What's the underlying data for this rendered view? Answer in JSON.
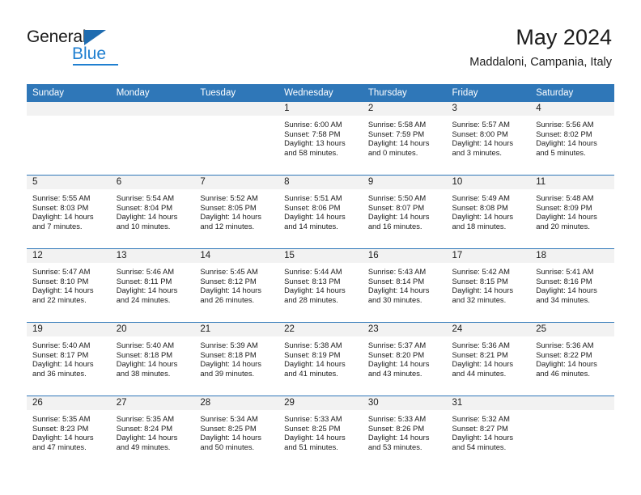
{
  "brand": {
    "name_part1": "General",
    "name_part2": "Blue",
    "triangle_color": "#1f6cb0",
    "blue_color": "#1f7fd0"
  },
  "header": {
    "title": "May 2024",
    "subtitle": "Maddaloni, Campania, Italy",
    "header_bg": "#2f77b8",
    "daynum_bg": "#f2f2f2"
  },
  "weekdays": [
    "Sunday",
    "Monday",
    "Tuesday",
    "Wednesday",
    "Thursday",
    "Friday",
    "Saturday"
  ],
  "labels": {
    "sunrise": "Sunrise:",
    "sunset": "Sunset:",
    "daylight": "Daylight:"
  },
  "weeks": [
    [
      {
        "empty": true
      },
      {
        "empty": true
      },
      {
        "empty": true
      },
      {
        "day": "1",
        "sunrise": "Sunrise: 6:00 AM",
        "sunset": "Sunset: 7:58 PM",
        "daylight_l1": "Daylight: 13 hours",
        "daylight_l2": "and 58 minutes."
      },
      {
        "day": "2",
        "sunrise": "Sunrise: 5:58 AM",
        "sunset": "Sunset: 7:59 PM",
        "daylight_l1": "Daylight: 14 hours",
        "daylight_l2": "and 0 minutes."
      },
      {
        "day": "3",
        "sunrise": "Sunrise: 5:57 AM",
        "sunset": "Sunset: 8:00 PM",
        "daylight_l1": "Daylight: 14 hours",
        "daylight_l2": "and 3 minutes."
      },
      {
        "day": "4",
        "sunrise": "Sunrise: 5:56 AM",
        "sunset": "Sunset: 8:02 PM",
        "daylight_l1": "Daylight: 14 hours",
        "daylight_l2": "and 5 minutes."
      }
    ],
    [
      {
        "day": "5",
        "sunrise": "Sunrise: 5:55 AM",
        "sunset": "Sunset: 8:03 PM",
        "daylight_l1": "Daylight: 14 hours",
        "daylight_l2": "and 7 minutes."
      },
      {
        "day": "6",
        "sunrise": "Sunrise: 5:54 AM",
        "sunset": "Sunset: 8:04 PM",
        "daylight_l1": "Daylight: 14 hours",
        "daylight_l2": "and 10 minutes."
      },
      {
        "day": "7",
        "sunrise": "Sunrise: 5:52 AM",
        "sunset": "Sunset: 8:05 PM",
        "daylight_l1": "Daylight: 14 hours",
        "daylight_l2": "and 12 minutes."
      },
      {
        "day": "8",
        "sunrise": "Sunrise: 5:51 AM",
        "sunset": "Sunset: 8:06 PM",
        "daylight_l1": "Daylight: 14 hours",
        "daylight_l2": "and 14 minutes."
      },
      {
        "day": "9",
        "sunrise": "Sunrise: 5:50 AM",
        "sunset": "Sunset: 8:07 PM",
        "daylight_l1": "Daylight: 14 hours",
        "daylight_l2": "and 16 minutes."
      },
      {
        "day": "10",
        "sunrise": "Sunrise: 5:49 AM",
        "sunset": "Sunset: 8:08 PM",
        "daylight_l1": "Daylight: 14 hours",
        "daylight_l2": "and 18 minutes."
      },
      {
        "day": "11",
        "sunrise": "Sunrise: 5:48 AM",
        "sunset": "Sunset: 8:09 PM",
        "daylight_l1": "Daylight: 14 hours",
        "daylight_l2": "and 20 minutes."
      }
    ],
    [
      {
        "day": "12",
        "sunrise": "Sunrise: 5:47 AM",
        "sunset": "Sunset: 8:10 PM",
        "daylight_l1": "Daylight: 14 hours",
        "daylight_l2": "and 22 minutes."
      },
      {
        "day": "13",
        "sunrise": "Sunrise: 5:46 AM",
        "sunset": "Sunset: 8:11 PM",
        "daylight_l1": "Daylight: 14 hours",
        "daylight_l2": "and 24 minutes."
      },
      {
        "day": "14",
        "sunrise": "Sunrise: 5:45 AM",
        "sunset": "Sunset: 8:12 PM",
        "daylight_l1": "Daylight: 14 hours",
        "daylight_l2": "and 26 minutes."
      },
      {
        "day": "15",
        "sunrise": "Sunrise: 5:44 AM",
        "sunset": "Sunset: 8:13 PM",
        "daylight_l1": "Daylight: 14 hours",
        "daylight_l2": "and 28 minutes."
      },
      {
        "day": "16",
        "sunrise": "Sunrise: 5:43 AM",
        "sunset": "Sunset: 8:14 PM",
        "daylight_l1": "Daylight: 14 hours",
        "daylight_l2": "and 30 minutes."
      },
      {
        "day": "17",
        "sunrise": "Sunrise: 5:42 AM",
        "sunset": "Sunset: 8:15 PM",
        "daylight_l1": "Daylight: 14 hours",
        "daylight_l2": "and 32 minutes."
      },
      {
        "day": "18",
        "sunrise": "Sunrise: 5:41 AM",
        "sunset": "Sunset: 8:16 PM",
        "daylight_l1": "Daylight: 14 hours",
        "daylight_l2": "and 34 minutes."
      }
    ],
    [
      {
        "day": "19",
        "sunrise": "Sunrise: 5:40 AM",
        "sunset": "Sunset: 8:17 PM",
        "daylight_l1": "Daylight: 14 hours",
        "daylight_l2": "and 36 minutes."
      },
      {
        "day": "20",
        "sunrise": "Sunrise: 5:40 AM",
        "sunset": "Sunset: 8:18 PM",
        "daylight_l1": "Daylight: 14 hours",
        "daylight_l2": "and 38 minutes."
      },
      {
        "day": "21",
        "sunrise": "Sunrise: 5:39 AM",
        "sunset": "Sunset: 8:18 PM",
        "daylight_l1": "Daylight: 14 hours",
        "daylight_l2": "and 39 minutes."
      },
      {
        "day": "22",
        "sunrise": "Sunrise: 5:38 AM",
        "sunset": "Sunset: 8:19 PM",
        "daylight_l1": "Daylight: 14 hours",
        "daylight_l2": "and 41 minutes."
      },
      {
        "day": "23",
        "sunrise": "Sunrise: 5:37 AM",
        "sunset": "Sunset: 8:20 PM",
        "daylight_l1": "Daylight: 14 hours",
        "daylight_l2": "and 43 minutes."
      },
      {
        "day": "24",
        "sunrise": "Sunrise: 5:36 AM",
        "sunset": "Sunset: 8:21 PM",
        "daylight_l1": "Daylight: 14 hours",
        "daylight_l2": "and 44 minutes."
      },
      {
        "day": "25",
        "sunrise": "Sunrise: 5:36 AM",
        "sunset": "Sunset: 8:22 PM",
        "daylight_l1": "Daylight: 14 hours",
        "daylight_l2": "and 46 minutes."
      }
    ],
    [
      {
        "day": "26",
        "sunrise": "Sunrise: 5:35 AM",
        "sunset": "Sunset: 8:23 PM",
        "daylight_l1": "Daylight: 14 hours",
        "daylight_l2": "and 47 minutes."
      },
      {
        "day": "27",
        "sunrise": "Sunrise: 5:35 AM",
        "sunset": "Sunset: 8:24 PM",
        "daylight_l1": "Daylight: 14 hours",
        "daylight_l2": "and 49 minutes."
      },
      {
        "day": "28",
        "sunrise": "Sunrise: 5:34 AM",
        "sunset": "Sunset: 8:25 PM",
        "daylight_l1": "Daylight: 14 hours",
        "daylight_l2": "and 50 minutes."
      },
      {
        "day": "29",
        "sunrise": "Sunrise: 5:33 AM",
        "sunset": "Sunset: 8:25 PM",
        "daylight_l1": "Daylight: 14 hours",
        "daylight_l2": "and 51 minutes."
      },
      {
        "day": "30",
        "sunrise": "Sunrise: 5:33 AM",
        "sunset": "Sunset: 8:26 PM",
        "daylight_l1": "Daylight: 14 hours",
        "daylight_l2": "and 53 minutes."
      },
      {
        "day": "31",
        "sunrise": "Sunrise: 5:32 AM",
        "sunset": "Sunset: 8:27 PM",
        "daylight_l1": "Daylight: 14 hours",
        "daylight_l2": "and 54 minutes."
      },
      {
        "empty": true
      }
    ]
  ]
}
